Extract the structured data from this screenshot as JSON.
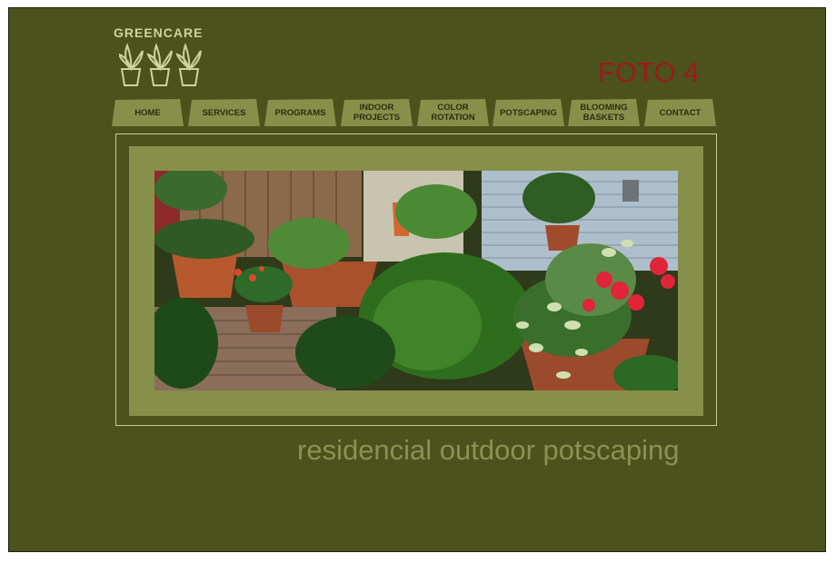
{
  "brand": {
    "name": "GREENCARE"
  },
  "page_label": "FOTO 4",
  "nav": [
    {
      "label": "HOME"
    },
    {
      "label": "SERVICES"
    },
    {
      "label": "PROGRAMS"
    },
    {
      "label": "INDOOR\nPROJECTS"
    },
    {
      "label": "COLOR\nROTATION"
    },
    {
      "label": "POTSCAPING"
    },
    {
      "label": "BLOOMING\nBASKETS"
    },
    {
      "label": "CONTACT"
    }
  ],
  "caption": "residencial outdoor potscaping",
  "colors": {
    "background": "#4c521c",
    "tab": "#87904a",
    "accent_red": "#9b1b1b",
    "caption": "#8b9152"
  }
}
